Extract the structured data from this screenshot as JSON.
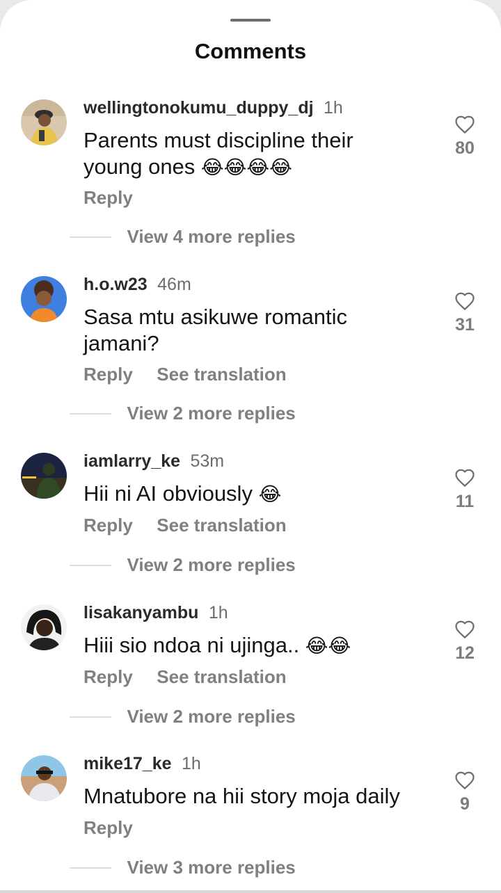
{
  "header": {
    "title": "Comments"
  },
  "comments": [
    {
      "username": "wellingtonokumu_duppy_dj",
      "time": "1h",
      "text": "Parents must discipline their young ones ",
      "emojis": "😂😂😂😂",
      "actions": {
        "reply": "Reply",
        "translate": ""
      },
      "likes": "80",
      "view_replies": "View 4 more replies"
    },
    {
      "username": "h.o.w23",
      "time": "46m",
      "text": "Sasa mtu asikuwe romantic jamani?",
      "emojis": "",
      "actions": {
        "reply": "Reply",
        "translate": "See translation"
      },
      "likes": "31",
      "view_replies": "View 2 more replies"
    },
    {
      "username": "iamlarry_ke",
      "time": "53m",
      "text": "Hii ni AI obviously ",
      "emojis": "😂",
      "actions": {
        "reply": "Reply",
        "translate": "See translation"
      },
      "likes": "11",
      "view_replies": "View 2 more replies"
    },
    {
      "username": "lisakanyambu",
      "time": "1h",
      "text": "Hiii sio ndoa ni ujinga.. ",
      "emojis": "😂😂",
      "actions": {
        "reply": "Reply",
        "translate": "See translation"
      },
      "likes": "12",
      "view_replies": "View 2 more replies"
    },
    {
      "username": "mike17_ke",
      "time": "1h",
      "text": "Mnatubore na hii story moja daily",
      "emojis": "",
      "actions": {
        "reply": "Reply",
        "translate": ""
      },
      "likes": "9",
      "view_replies": "View 3 more replies"
    }
  ],
  "icons": {
    "like": "heart-outline-icon"
  },
  "colors": {
    "text": "#151515",
    "muted": "#7f7f84",
    "background": "#ffffff"
  }
}
